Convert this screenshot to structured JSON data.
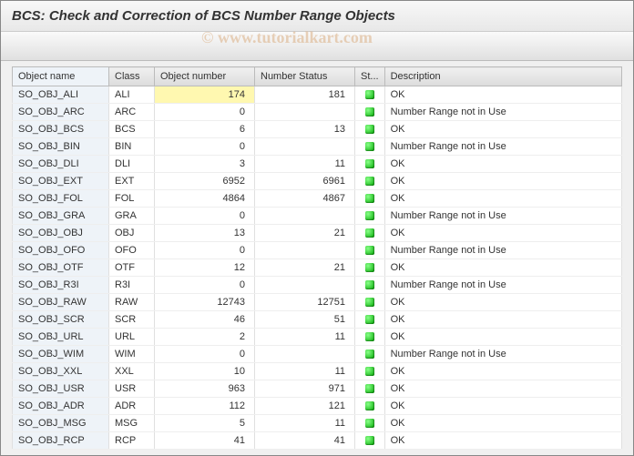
{
  "title": "BCS: Check and Correction of BCS Number Range Objects",
  "watermark": "© www.tutorialkart.com",
  "columns": {
    "objname": "Object name",
    "class": "Class",
    "objnum": "Object number",
    "numstat": "Number Status",
    "st": "St...",
    "desc": "Description"
  },
  "rows": [
    {
      "objname": "SO_OBJ_ALI",
      "class": "ALI",
      "objnum": "174",
      "numstat": "181",
      "status": "green",
      "desc": "OK",
      "selected": true
    },
    {
      "objname": "SO_OBJ_ARC",
      "class": "ARC",
      "objnum": "0",
      "numstat": "",
      "status": "green",
      "desc": "Number Range not in Use"
    },
    {
      "objname": "SO_OBJ_BCS",
      "class": "BCS",
      "objnum": "6",
      "numstat": "13",
      "status": "green",
      "desc": "OK"
    },
    {
      "objname": "SO_OBJ_BIN",
      "class": "BIN",
      "objnum": "0",
      "numstat": "",
      "status": "green",
      "desc": "Number Range not in Use"
    },
    {
      "objname": "SO_OBJ_DLI",
      "class": "DLI",
      "objnum": "3",
      "numstat": "11",
      "status": "green",
      "desc": "OK"
    },
    {
      "objname": "SO_OBJ_EXT",
      "class": "EXT",
      "objnum": "6952",
      "numstat": "6961",
      "status": "green",
      "desc": "OK"
    },
    {
      "objname": "SO_OBJ_FOL",
      "class": "FOL",
      "objnum": "4864",
      "numstat": "4867",
      "status": "green",
      "desc": "OK"
    },
    {
      "objname": "SO_OBJ_GRA",
      "class": "GRA",
      "objnum": "0",
      "numstat": "",
      "status": "green",
      "desc": "Number Range not in Use"
    },
    {
      "objname": "SO_OBJ_OBJ",
      "class": "OBJ",
      "objnum": "13",
      "numstat": "21",
      "status": "green",
      "desc": "OK"
    },
    {
      "objname": "SO_OBJ_OFO",
      "class": "OFO",
      "objnum": "0",
      "numstat": "",
      "status": "green",
      "desc": "Number Range not in Use"
    },
    {
      "objname": "SO_OBJ_OTF",
      "class": "OTF",
      "objnum": "12",
      "numstat": "21",
      "status": "green",
      "desc": "OK"
    },
    {
      "objname": "SO_OBJ_R3I",
      "class": "R3I",
      "objnum": "0",
      "numstat": "",
      "status": "green",
      "desc": "Number Range not in Use"
    },
    {
      "objname": "SO_OBJ_RAW",
      "class": "RAW",
      "objnum": "12743",
      "numstat": "12751",
      "status": "green",
      "desc": "OK"
    },
    {
      "objname": "SO_OBJ_SCR",
      "class": "SCR",
      "objnum": "46",
      "numstat": "51",
      "status": "green",
      "desc": "OK"
    },
    {
      "objname": "SO_OBJ_URL",
      "class": "URL",
      "objnum": "2",
      "numstat": "11",
      "status": "green",
      "desc": "OK"
    },
    {
      "objname": "SO_OBJ_WIM",
      "class": "WIM",
      "objnum": "0",
      "numstat": "",
      "status": "green",
      "desc": "Number Range not in Use"
    },
    {
      "objname": "SO_OBJ_XXL",
      "class": "XXL",
      "objnum": "10",
      "numstat": "11",
      "status": "green",
      "desc": "OK"
    },
    {
      "objname": "SO_OBJ_USR",
      "class": "USR",
      "objnum": "963",
      "numstat": "971",
      "status": "green",
      "desc": "OK"
    },
    {
      "objname": "SO_OBJ_ADR",
      "class": "ADR",
      "objnum": "112",
      "numstat": "121",
      "status": "green",
      "desc": "OK"
    },
    {
      "objname": "SO_OBJ_MSG",
      "class": "MSG",
      "objnum": "5",
      "numstat": "11",
      "status": "green",
      "desc": "OK"
    },
    {
      "objname": "SO_OBJ_RCP",
      "class": "RCP",
      "objnum": "41",
      "numstat": "41",
      "status": "green",
      "desc": "OK"
    }
  ]
}
